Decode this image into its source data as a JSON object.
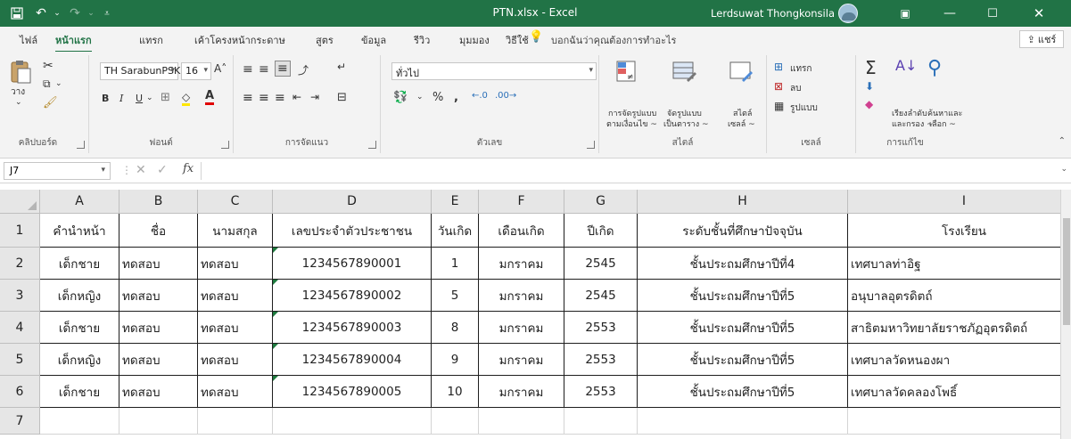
{
  "titlebar": {
    "title": "PTN.xlsx  -  Excel",
    "user": "Lerdsuwat Thongkonsila",
    "bg_color": "#217346"
  },
  "tabs": [
    {
      "label": "ไฟล์",
      "active": false
    },
    {
      "label": "หน้าแรก",
      "active": true
    },
    {
      "label": "แทรก",
      "active": false
    },
    {
      "label": "เค้าโครงหน้ากระดาษ",
      "active": false
    },
    {
      "label": "สูตร",
      "active": false
    },
    {
      "label": "ข้อมูล",
      "active": false
    },
    {
      "label": "รีวิว",
      "active": false
    },
    {
      "label": "มุมมอง",
      "active": false
    },
    {
      "label": "วิธีใช้",
      "active": false
    }
  ],
  "tell_me": "บอกฉันว่าคุณต้องการทำอะไร",
  "share_label": "แชร์",
  "ribbon": {
    "clipboard": {
      "paste": "วาง",
      "label": "คลิปบอร์ด"
    },
    "font": {
      "name": "TH SarabunPSK",
      "size": "16",
      "bold": "B",
      "italic": "I",
      "underline": "U",
      "label": "ฟอนต์"
    },
    "alignment": {
      "label": "การจัดแนว"
    },
    "number": {
      "format": "ทั่วไป",
      "percent": "%",
      "comma": ",",
      "label": "ตัวเลข"
    },
    "styles": {
      "conditional": [
        "การจัดรูปแบบ",
        "ตามเงื่อนไข ~"
      ],
      "as_table": [
        "จัดรูปแบบ",
        "เป็นตาราง ~"
      ],
      "cell_styles": [
        "สไตล์",
        "เซลล์ ~"
      ],
      "label": "สไตล์"
    },
    "cells": {
      "insert": "แทรก",
      "delete": "ลบ",
      "format": "รูปแบบ",
      "label": "เซลล์"
    },
    "editing": {
      "sort": [
        "เรียงลำดับ",
        "และกรอง ~"
      ],
      "find": [
        "ค้นหาและ",
        "เลือก ~"
      ],
      "label": "การแก้ไข"
    }
  },
  "formula_bar": {
    "name_box": "J7",
    "fx": "fx",
    "formula": ""
  },
  "sheet": {
    "columns": [
      "A",
      "B",
      "C",
      "D",
      "E",
      "F",
      "G",
      "H",
      "I"
    ],
    "rows": [
      "1",
      "2",
      "3",
      "4",
      "5",
      "6",
      "7"
    ],
    "headers": [
      "คำนำหน้า",
      "ชื่อ",
      "นามสกุล",
      "เลขประจำตัวประชาชน",
      "วันเกิด",
      "เดือนเกิด",
      "ปีเกิด",
      "ระดับชั้นที่ศึกษาปัจจุบัน",
      "โรงเรียน"
    ],
    "data": [
      [
        "เด็กชาย",
        "ทดสอบ",
        "ทดสอบ",
        "1234567890001",
        "1",
        "มกราคม",
        "2545",
        "ชั้นประถมศึกษาปีที่4",
        "เทศบาลท่าอิฐ"
      ],
      [
        "เด็กหญิง",
        "ทดสอบ",
        "ทดสอบ",
        "1234567890002",
        "5",
        "มกราคม",
        "2545",
        "ชั้นประถมศึกษาปีที่5",
        "อนุบาลอุตรดิตถ์"
      ],
      [
        "เด็กชาย",
        "ทดสอบ",
        "ทดสอบ",
        "1234567890003",
        "8",
        "มกราคม",
        "2553",
        "ชั้นประถมศึกษาปีที่5",
        "สาธิตมหาวิทยาลัยราชภัฏอุตรดิตถ์"
      ],
      [
        "เด็กหญิง",
        "ทดสอบ",
        "ทดสอบ",
        "1234567890004",
        "9",
        "มกราคม",
        "2553",
        "ชั้นประถมศึกษาปีที่5",
        "เทศบาลวัดหนองผา"
      ],
      [
        "เด็กชาย",
        "ทดสอบ",
        "ทดสอบ",
        "1234567890005",
        "10",
        "มกราคม",
        "2553",
        "ชั้นประถมศึกษาปีที่5",
        "เทศบาลวัดคลองโพธิ์"
      ]
    ]
  }
}
